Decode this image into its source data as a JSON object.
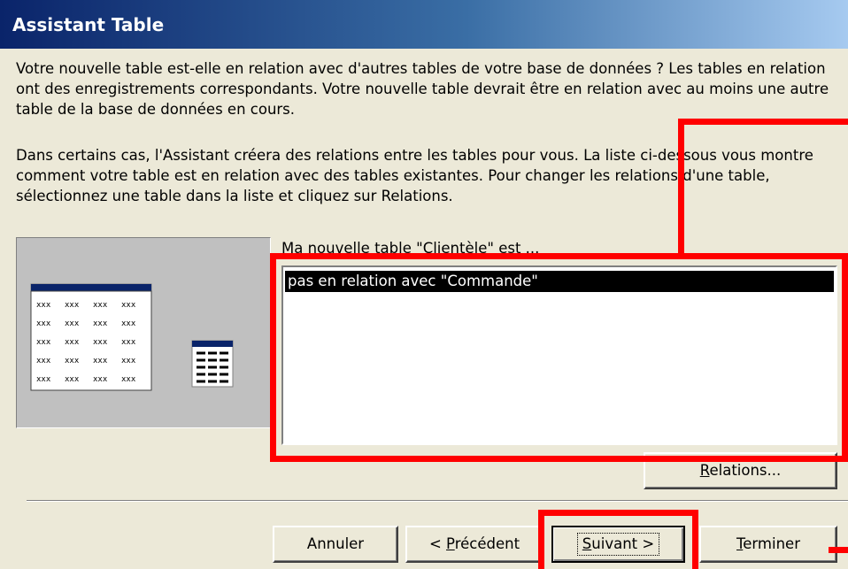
{
  "window": {
    "title": "Assistant Table"
  },
  "text": {
    "paragraph1": "Votre nouvelle table est-elle en relation avec d'autres tables de votre base de données ? Les tables en relation ont des enregistrements correspondants. Votre nouvelle table devrait être en relation avec au moins une autre table de la base de données en cours.",
    "paragraph2": "Dans certains cas, l'Assistant créera des relations entre les tables pour vous. La liste ci-dessous vous montre comment votre table est en relation avec des tables existantes. Pour changer les relations d'une table, sélectionnez une table dans la liste et cliquez sur Relations."
  },
  "list": {
    "label": "Ma nouvelle table \"Clientèle\" est ...",
    "items": [
      "pas en relation avec \"Commande\""
    ],
    "selected_index": 0
  },
  "picture": {
    "table_cell_text": "xxx",
    "rows": 5,
    "cols": 4
  },
  "buttons": {
    "relations_prefix": "R",
    "relations_rest": "elations...",
    "cancel": "Annuler",
    "back_pre": "< ",
    "back_accel": "P",
    "back_rest": "récédent",
    "next_accel": "S",
    "next_rest": "uivant >",
    "finish_accel": "T",
    "finish_rest": "erminer"
  },
  "colors": {
    "titlebar_start": "#0a246a",
    "titlebar_end": "#a6caf0",
    "dialog_bg": "#ece9d8",
    "highlight_annotation": "#ff0000",
    "selection_bg": "#000000"
  }
}
